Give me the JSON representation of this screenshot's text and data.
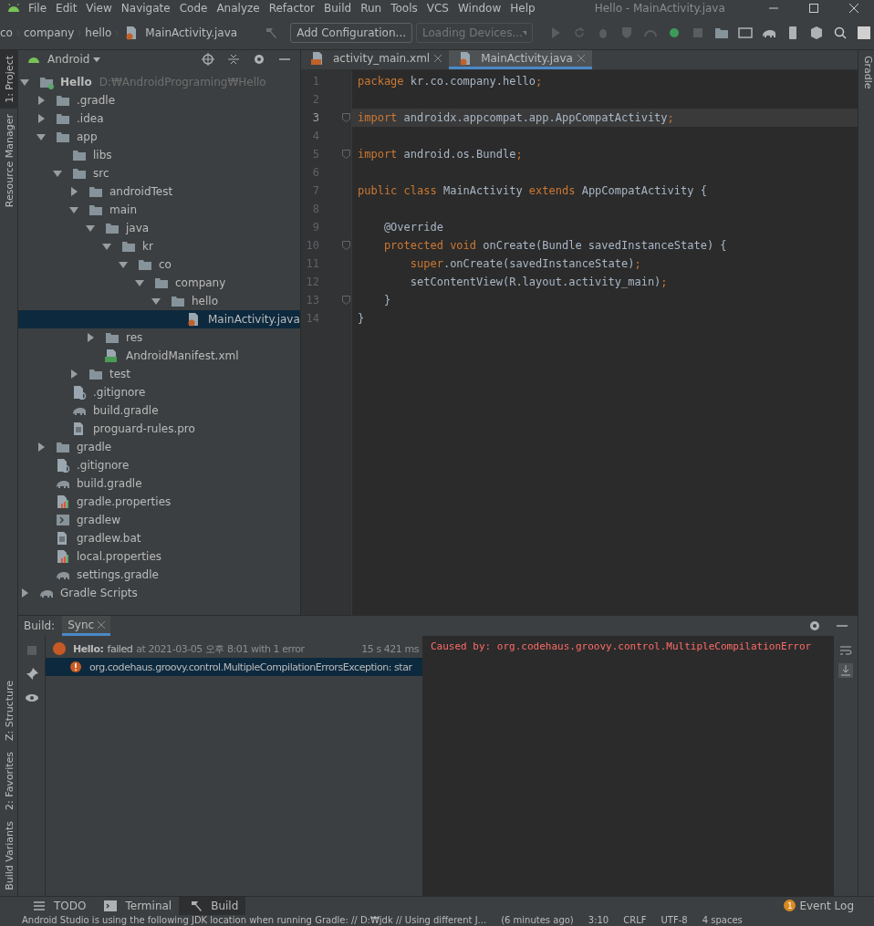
{
  "window": {
    "title": "Hello - MainActivity.java"
  },
  "menu": [
    "File",
    "Edit",
    "View",
    "Navigate",
    "Code",
    "Analyze",
    "Refactor",
    "Build",
    "Run",
    "Tools",
    "VCS",
    "Window",
    "Help"
  ],
  "breadcrumbs": [
    "co",
    "company",
    "hello",
    "MainActivity.java"
  ],
  "run_config": {
    "label": "Add Configuration..."
  },
  "device_select": {
    "value": "Loading Devices...",
    "disabled": true
  },
  "left_strip": [
    {
      "label": "1: Project",
      "selected": true
    },
    {
      "label": "Resource Manager",
      "selected": false
    }
  ],
  "left_strip_bottom": [
    {
      "label": "Z: Structure",
      "selected": false
    },
    {
      "label": "2: Favorites",
      "selected": false
    },
    {
      "label": "Build Variants",
      "selected": false
    }
  ],
  "right_strip": [
    {
      "label": "Gradle",
      "selected": false
    }
  ],
  "project_panel": {
    "view": "Android",
    "tree": [
      {
        "name": "Hello",
        "path": "D:₩AndroidPrograming₩Hello",
        "kind": "module",
        "expanded": true,
        "selected": false,
        "children": [
          {
            "name": ".gradle",
            "kind": "folder",
            "expanded": false,
            "selected": false
          },
          {
            "name": ".idea",
            "kind": "folder",
            "expanded": false,
            "selected": false
          },
          {
            "name": "app",
            "kind": "folder",
            "expanded": true,
            "selected": false,
            "children": [
              {
                "name": "libs",
                "kind": "folder",
                "selected": false
              },
              {
                "name": "src",
                "kind": "folder",
                "expanded": true,
                "selected": false,
                "children": [
                  {
                    "name": "androidTest",
                    "kind": "folder",
                    "expanded": false,
                    "selected": false
                  },
                  {
                    "name": "main",
                    "kind": "folder",
                    "expanded": true,
                    "selected": false,
                    "children": [
                      {
                        "name": "java",
                        "kind": "folder",
                        "expanded": true,
                        "selected": false,
                        "children": [
                          {
                            "name": "kr",
                            "kind": "folder",
                            "expanded": true,
                            "selected": false,
                            "children": [
                              {
                                "name": "co",
                                "kind": "folder",
                                "expanded": true,
                                "selected": false,
                                "children": [
                                  {
                                    "name": "company",
                                    "kind": "folder",
                                    "expanded": true,
                                    "selected": false,
                                    "children": [
                                      {
                                        "name": "hello",
                                        "kind": "folder",
                                        "expanded": true,
                                        "selected": false,
                                        "children": [
                                          {
                                            "name": "MainActivity.java",
                                            "kind": "java",
                                            "selected": true
                                          }
                                        ]
                                      }
                                    ]
                                  }
                                ]
                              }
                            ]
                          }
                        ]
                      },
                      {
                        "name": "res",
                        "kind": "folder",
                        "expanded": false,
                        "selected": false
                      },
                      {
                        "name": "AndroidManifest.xml",
                        "kind": "manifest",
                        "selected": false
                      }
                    ]
                  },
                  {
                    "name": "test",
                    "kind": "folder",
                    "expanded": false,
                    "selected": false
                  }
                ]
              },
              {
                "name": ".gitignore",
                "kind": "ignore",
                "selected": false
              },
              {
                "name": "build.gradle",
                "kind": "gradle",
                "selected": false
              },
              {
                "name": "proguard-rules.pro",
                "kind": "text",
                "selected": false
              }
            ]
          },
          {
            "name": "gradle",
            "kind": "folder",
            "expanded": false,
            "selected": false
          },
          {
            "name": ".gitignore",
            "kind": "ignore",
            "selected": false
          },
          {
            "name": "build.gradle",
            "kind": "gradle",
            "selected": false
          },
          {
            "name": "gradle.properties",
            "kind": "properties",
            "selected": false
          },
          {
            "name": "gradlew",
            "kind": "shell",
            "selected": false
          },
          {
            "name": "gradlew.bat",
            "kind": "text",
            "selected": false
          },
          {
            "name": "local.properties",
            "kind": "properties",
            "selected": false
          },
          {
            "name": "settings.gradle",
            "kind": "gradle",
            "selected": false
          }
        ]
      },
      {
        "name": "Gradle Scripts",
        "kind": "gradle",
        "expanded": false,
        "selected": false
      }
    ]
  },
  "editor_tabs": [
    {
      "label": "activity_main.xml",
      "kind": "xml",
      "selected": false
    },
    {
      "label": "MainActivity.java",
      "kind": "java",
      "selected": true
    }
  ],
  "code_lines": [
    {
      "number": "1",
      "current": false,
      "fold": false,
      "tokens": [
        {
          "kind": "keyword",
          "text": "package"
        },
        {
          "kind": "plain",
          "text": " kr.co.company.hello"
        },
        {
          "kind": "keyword",
          "text": ";"
        }
      ]
    },
    {
      "number": "2",
      "current": false,
      "fold": false
    },
    {
      "number": "3",
      "current": true,
      "fold": true,
      "tokens": [
        {
          "kind": "keyword",
          "text": "import"
        },
        {
          "kind": "plain",
          "text": " androidx.appcompat.app.AppCompatActivity"
        },
        {
          "kind": "keyword",
          "text": ";"
        }
      ]
    },
    {
      "number": "4",
      "current": false,
      "fold": false
    },
    {
      "number": "5",
      "current": false,
      "fold": true,
      "tokens": [
        {
          "kind": "keyword",
          "text": "import"
        },
        {
          "kind": "plain",
          "text": " android.os.Bundle"
        },
        {
          "kind": "keyword",
          "text": ";"
        }
      ]
    },
    {
      "number": "6",
      "current": false,
      "fold": false
    },
    {
      "number": "7",
      "current": false,
      "fold": false,
      "tokens": [
        {
          "kind": "keyword",
          "text": "public class"
        },
        {
          "kind": "plain",
          "text": " MainActivity "
        },
        {
          "kind": "keyword",
          "text": "extends"
        },
        {
          "kind": "plain",
          "text": " AppCompatActivity {"
        }
      ]
    },
    {
      "number": "8",
      "current": false,
      "fold": false
    },
    {
      "number": "9",
      "current": false,
      "fold": false,
      "tokens": [
        {
          "kind": "plain",
          "text": "    @Override"
        }
      ]
    },
    {
      "number": "10",
      "current": false,
      "fold": true,
      "tokens": [
        {
          "kind": "keyword",
          "text": "    protected void"
        },
        {
          "kind": "plain",
          "text": " onCreate(Bundle savedInstanceState) {"
        }
      ]
    },
    {
      "number": "11",
      "current": false,
      "fold": false,
      "tokens": [
        {
          "kind": "keyword",
          "text": "        super"
        },
        {
          "kind": "plain",
          "text": ".onCreate(savedInstanceState)"
        },
        {
          "kind": "keyword",
          "text": ";"
        }
      ]
    },
    {
      "number": "12",
      "current": false,
      "fold": false,
      "tokens": [
        {
          "kind": "plain",
          "text": "        setContentView(R.layout.activity_main)"
        },
        {
          "kind": "keyword",
          "text": ";"
        }
      ]
    },
    {
      "number": "13",
      "current": false,
      "fold": true,
      "tokens": [
        {
          "kind": "plain",
          "text": "    }"
        }
      ]
    },
    {
      "number": "14",
      "current": false,
      "fold": false,
      "tokens": [
        {
          "kind": "plain",
          "text": "}"
        }
      ]
    }
  ],
  "build_panel": {
    "label": "Build:",
    "tabs": [
      {
        "label": "Sync",
        "selected": true
      }
    ],
    "tree": [
      {
        "kind": "result",
        "title": "Hello:",
        "status": "failed",
        "detail": "at 2021-03-05 오후 8:01 with 1 error",
        "time": "15 s 421 ms",
        "selected": false
      },
      {
        "kind": "error",
        "title": "org.codehaus.groovy.control.MultipleCompilationErrorsException: star",
        "selected": true
      }
    ],
    "console": "Caused by: org.codehaus.groovy.control.MultipleCompilationError"
  },
  "tool_tabs": [
    {
      "label": "TODO",
      "kind": "list",
      "selected": false
    },
    {
      "label": "Terminal",
      "kind": "terminal",
      "selected": false
    },
    {
      "label": "Build",
      "kind": "hammer",
      "selected": true
    }
  ],
  "event_log": {
    "label": "Event Log",
    "count": "1"
  },
  "status_bar": {
    "message": "Android Studio is using the following JDK location when running Gradle: // D:₩jdk // Using different J...",
    "age": "(6 minutes ago)",
    "items": [
      "3:10",
      "CRLF",
      "UTF-8",
      "4 spaces"
    ]
  }
}
